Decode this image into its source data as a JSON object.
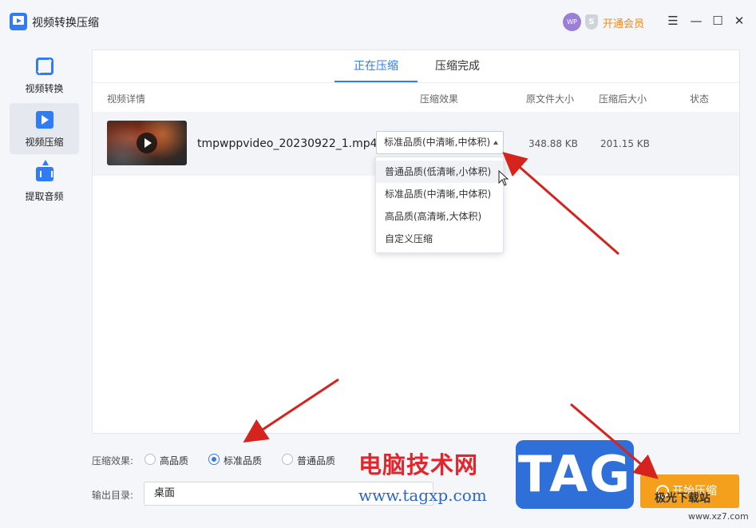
{
  "app": {
    "title": "视频转换压缩"
  },
  "header": {
    "avatar_text": "WP",
    "vip_icon_text": "S",
    "vip_label": "开通会员"
  },
  "window_controls": {
    "menu": "☰",
    "minimize": "—",
    "maximize": "☐",
    "close": "✕"
  },
  "sidebar": {
    "items": [
      {
        "label": "视频转换",
        "icon": "convert-icon",
        "active": false
      },
      {
        "label": "视频压缩",
        "icon": "compress-icon",
        "active": true
      },
      {
        "label": "提取音频",
        "icon": "extract-audio-icon",
        "active": false
      }
    ]
  },
  "tabs": [
    {
      "label": "正在压缩",
      "active": true
    },
    {
      "label": "压缩完成",
      "active": false
    }
  ],
  "columns": [
    "视频详情",
    "压缩效果",
    "原文件大小",
    "压缩后大小",
    "状态"
  ],
  "file": {
    "name": "tmpwppvideo_20230922_1.mp4",
    "quality": "标准品质(中清晰,中体积)",
    "original_size": "348.88 KB",
    "compressed_size": "201.15 KB"
  },
  "dropdown": {
    "options": [
      "普通品质(低清晰,小体积)",
      "标准品质(中清晰,中体积)",
      "高品质(高清晰,大体积)",
      "自定义压缩"
    ]
  },
  "bottom": {
    "effect_label": "压缩效果:",
    "options": [
      "高品质",
      "标准品质",
      "普通品质"
    ],
    "selected": "标准品质",
    "output_label": "输出目录:",
    "output_value": "桌面",
    "start_label": "开始压缩"
  },
  "watermark": {
    "cn": "电脑技术网",
    "url": "www.tagxp.com",
    "tag": "TAG",
    "site": "极光下载站",
    "site_url": "www.xz7.com"
  },
  "colors": {
    "accent": "#2f7cf6",
    "vip": "#f08a24",
    "start": "#f5a01d",
    "arrow": "#d6231e"
  }
}
